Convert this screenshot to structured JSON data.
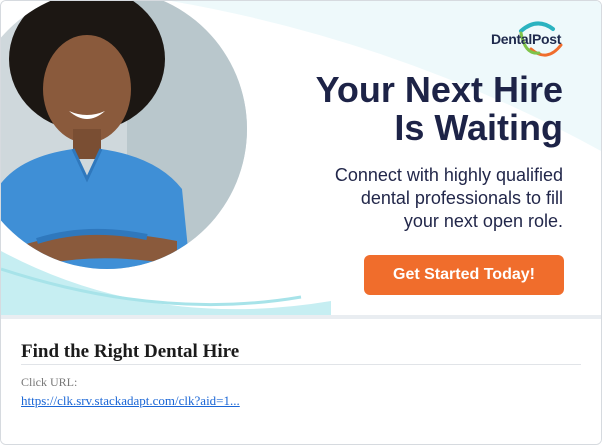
{
  "ad": {
    "logo_text": "DentalPost",
    "headline_line1": "Your Next Hire",
    "headline_line2": "Is Waiting",
    "subtext_line1": "Connect with highly qualified",
    "subtext_line2": "dental professionals to fill",
    "subtext_line3": "your next open role.",
    "cta_label": "Get Started Today!"
  },
  "details": {
    "title": "Find the Right Dental Hire",
    "click_label": "Click URL:",
    "click_url": "https://clk.srv.stackadapt.com/clk?aid=1..."
  },
  "colors": {
    "cta": "#f06d2c",
    "headline": "#1d2347",
    "accent_teal": "#2bb3c0",
    "link": "#1a66d6"
  }
}
